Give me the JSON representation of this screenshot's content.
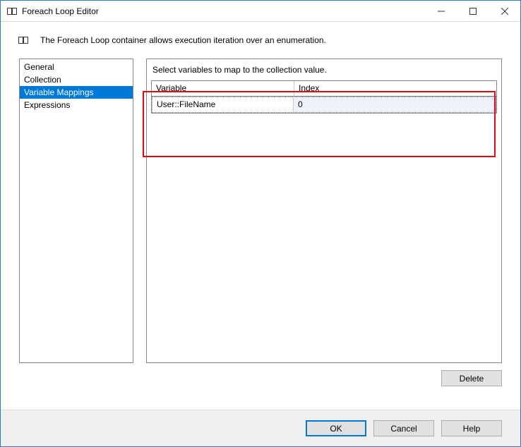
{
  "window": {
    "title": "Foreach Loop Editor"
  },
  "description": "The Foreach Loop container allows execution iteration over an enumeration.",
  "nav": {
    "items": [
      {
        "label": "General"
      },
      {
        "label": "Collection"
      },
      {
        "label": "Variable Mappings"
      },
      {
        "label": "Expressions"
      }
    ],
    "selected_index": 2
  },
  "main": {
    "instruction": "Select variables to map to the collection value.",
    "grid": {
      "headers": {
        "variable": "Variable",
        "index": "Index"
      },
      "rows": [
        {
          "variable": "User::FileName",
          "index": "0"
        }
      ]
    }
  },
  "buttons": {
    "delete": "Delete",
    "ok": "OK",
    "cancel": "Cancel",
    "help": "Help"
  }
}
